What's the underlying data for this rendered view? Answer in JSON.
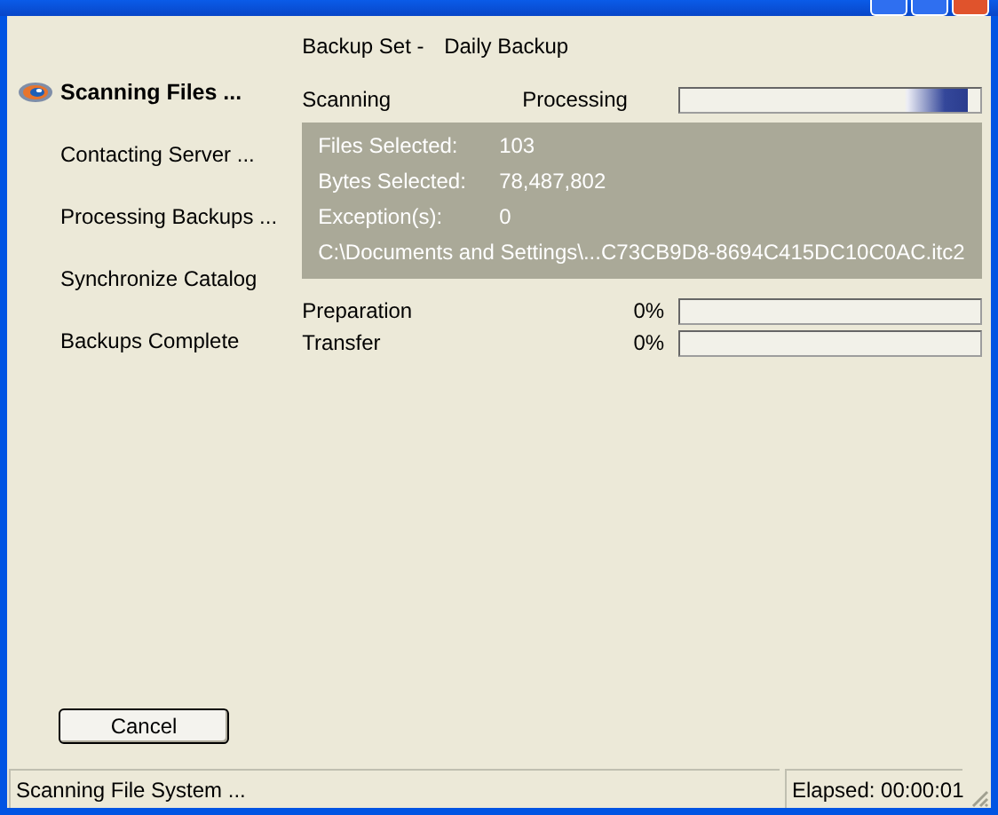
{
  "backup_set": {
    "label": "Backup Set -",
    "value": "Daily Backup"
  },
  "steps": [
    {
      "label": "Scanning Files ...",
      "selected": true
    },
    {
      "label": "Contacting Server ...",
      "selected": false
    },
    {
      "label": "Processing Backups ...",
      "selected": false
    },
    {
      "label": "Synchronize Catalog",
      "selected": false
    },
    {
      "label": "Backups Complete",
      "selected": false
    }
  ],
  "scanning": {
    "label": "Scanning",
    "status": "Processing",
    "level": 0.96
  },
  "details": [
    {
      "label": "Files Selected:",
      "value": "103"
    },
    {
      "label": "Bytes Selected:",
      "value": "78,487,802"
    },
    {
      "label": "Exception(s):",
      "value": "0"
    }
  ],
  "current_path": "C:\\Documents and Settings\\...C73CB9D8-8694C415DC10C0AC.itc2",
  "progress": [
    {
      "label": "Preparation",
      "percent": "0%",
      "level": 0
    },
    {
      "label": "Transfer",
      "percent": "0%",
      "level": 0
    }
  ],
  "cancel_button": "Cancel",
  "status_bar": {
    "message": "Scanning File System ...",
    "elapsed": "Elapsed: 00:00:01"
  }
}
